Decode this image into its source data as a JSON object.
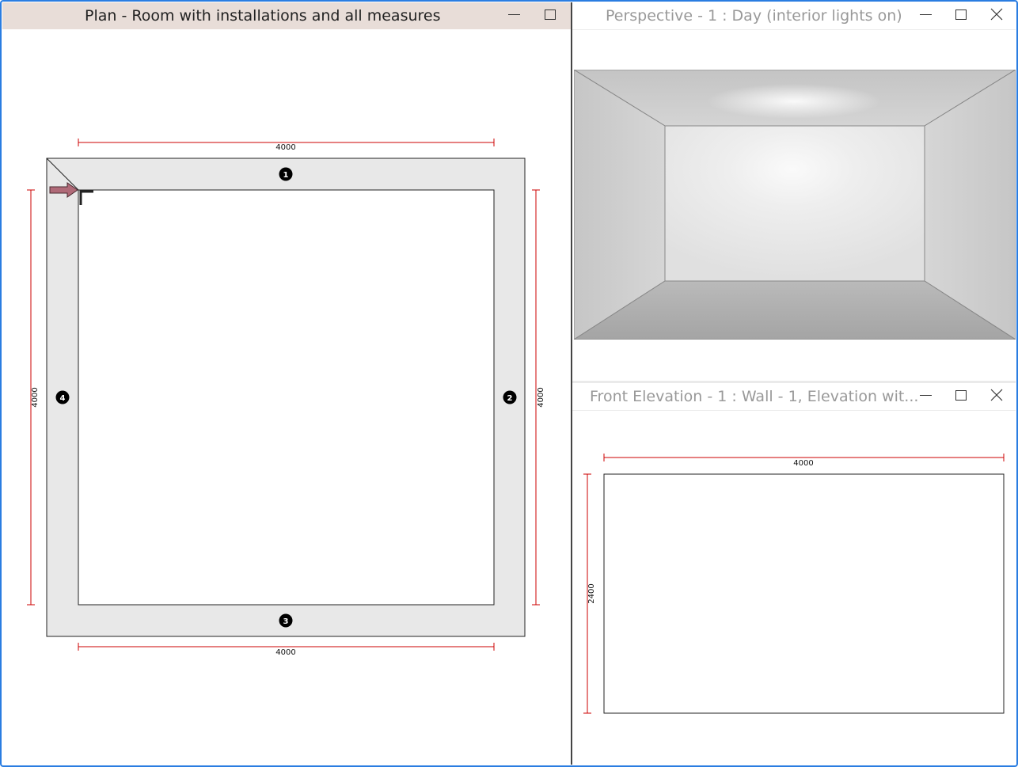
{
  "plan_window": {
    "title": "Plan - Room with installations and all measures",
    "dims": {
      "top": "4000",
      "bottom": "4000",
      "left": "4000",
      "right": "4000"
    },
    "wall_markers": [
      "1",
      "2",
      "3",
      "4"
    ]
  },
  "perspective_window": {
    "title": "Perspective - 1 : Day (interior lights on)"
  },
  "elevation_window": {
    "title": "Front Elevation - 1 : Wall - 1, Elevation wit...",
    "dims": {
      "width": "4000",
      "height": "2400"
    }
  },
  "colors": {
    "accent_border": "#2a7de1",
    "dimension_line": "#cc0000",
    "active_titlebar": "#e8ddd8",
    "wall_fill": "#e8e8e8",
    "entry_arrow": "#b06a78"
  }
}
